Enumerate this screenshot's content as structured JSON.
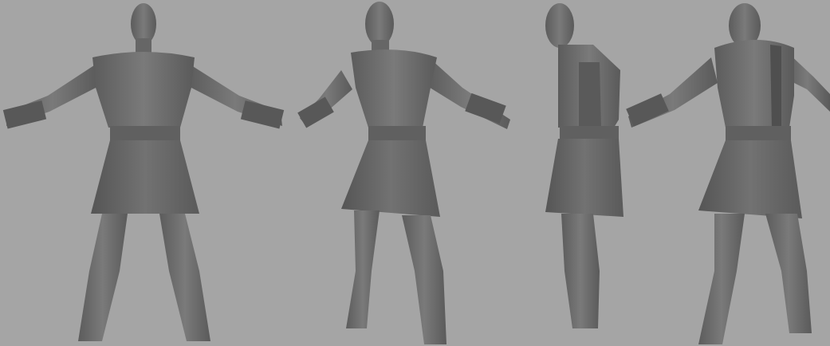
{
  "scene": {
    "description_visible_text": "",
    "background_color": "#a5a5a5",
    "model_color": "#6b6b6b",
    "views": [
      {
        "id": "front"
      },
      {
        "id": "three-quarter-front"
      },
      {
        "id": "side"
      },
      {
        "id": "three-quarter-back"
      }
    ]
  }
}
